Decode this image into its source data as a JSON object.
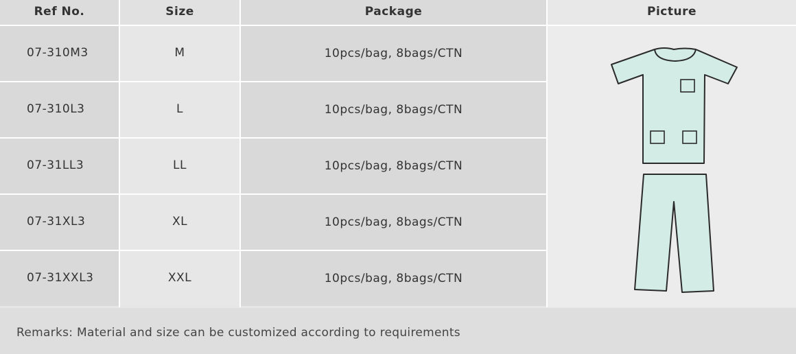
{
  "table": {
    "headers": {
      "ref": "Ref No.",
      "size": "Size",
      "package": "Package",
      "picture": "Picture"
    },
    "rows": [
      {
        "ref": "07-310M3",
        "size": "M",
        "package": "10pcs/bag, 8bags/CTN"
      },
      {
        "ref": "07-310L3",
        "size": "L",
        "package": "10pcs/bag, 8bags/CTN"
      },
      {
        "ref": "07-31LL3",
        "size": "LL",
        "package": "10pcs/bag, 8bags/CTN"
      },
      {
        "ref": "07-31XL3",
        "size": "XL",
        "package": "10pcs/bag, 8bags/CTN"
      },
      {
        "ref": "07-31XXL3",
        "size": "XXL",
        "package": "10pcs/bag, 8bags/CTN"
      }
    ]
  },
  "picture": {
    "icon": "scrub-suit-icon",
    "fill_color": "#d3ece6",
    "stroke_color": "#2a2a2a"
  },
  "remarks": "Remarks: Material and size can be customized according to requirements"
}
